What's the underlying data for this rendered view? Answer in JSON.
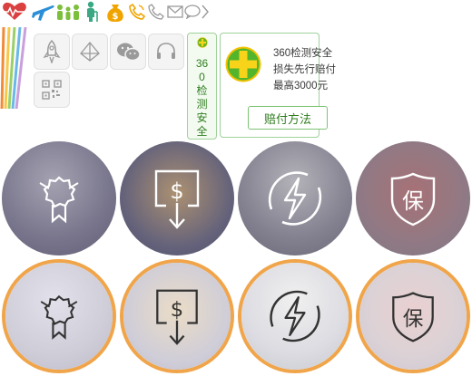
{
  "top_icons": [
    {
      "name": "heart-pulse-icon",
      "color": "#d9403f"
    },
    {
      "name": "airplane-icon",
      "color": "#2a8fd8"
    },
    {
      "name": "family-icon",
      "color": "#7cbf3a"
    },
    {
      "name": "elderly-icon",
      "color": "#3aa882"
    },
    {
      "name": "money-bag-icon",
      "color": "#f0a400"
    },
    {
      "name": "phone-icon",
      "color": "#f0a400"
    },
    {
      "name": "phone-outline-icon",
      "color": "#9a9a9a"
    },
    {
      "name": "mail-icon",
      "color": "#9a9a9a"
    },
    {
      "name": "chat-bubble-icon",
      "color": "#9a9a9a"
    },
    {
      "name": "chevron-right-icon",
      "color": "#9a9a9a"
    }
  ],
  "share_tiles": [
    {
      "name": "rocket-icon"
    },
    {
      "name": "paper-plane-icon"
    },
    {
      "name": "wechat-icon"
    },
    {
      "name": "headset-icon"
    },
    {
      "name": "qr-code-icon"
    }
  ],
  "security_bar": {
    "text": "360检测安全"
  },
  "security_panel": {
    "line1": "360检测安全",
    "line2": "损失先行赔付",
    "line3": "最高3000元",
    "button": "赔付方法"
  },
  "feature_circles": [
    {
      "name": "award-ribbon-icon",
      "row": 1
    },
    {
      "name": "dollar-download-icon",
      "row": 1
    },
    {
      "name": "lightning-icon",
      "row": 1
    },
    {
      "name": "shield-bao-icon",
      "row": 1,
      "glyph": "保"
    },
    {
      "name": "award-ribbon-icon",
      "row": 2
    },
    {
      "name": "dollar-download-icon",
      "row": 2
    },
    {
      "name": "lightning-icon",
      "row": 2
    },
    {
      "name": "shield-bao-icon",
      "row": 2,
      "glyph": "保"
    }
  ],
  "colors": {
    "accent_green": "#2f7d1f",
    "border_green": "#9ed19a",
    "ring_orange": "#f0a54a"
  }
}
